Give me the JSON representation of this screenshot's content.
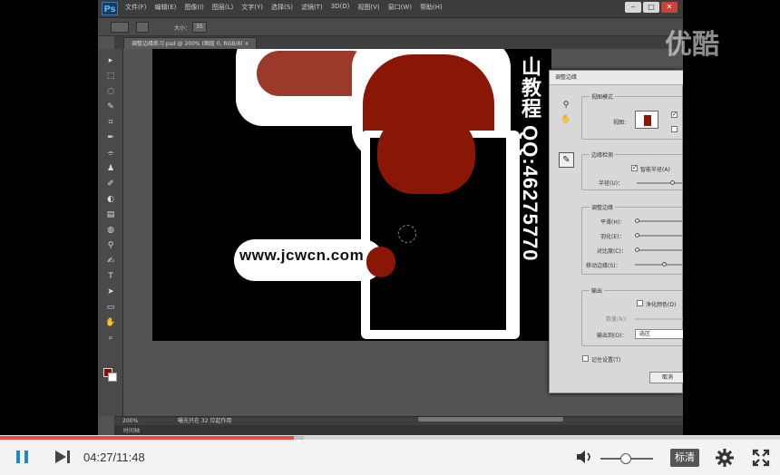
{
  "photoshop": {
    "logo": "Ps",
    "menu": [
      "文件(F)",
      "编辑(E)",
      "图像(I)",
      "图层(L)",
      "文字(Y)",
      "选择(S)",
      "滤镜(T)",
      "3D(D)",
      "视图(V)",
      "窗口(W)",
      "帮助(H)"
    ],
    "window_buttons": [
      "‒",
      "□",
      "✕"
    ],
    "options_bar": {
      "size_label": "大小：",
      "size_value": "35"
    },
    "document_tab": "调整边缘练习.psd @ 200% (图层 0, RGB/8) ×",
    "tools": [
      "▸",
      "⬚",
      "◌",
      "✎",
      "⌗",
      "✒",
      "⌯",
      "♟",
      "✐",
      "◐",
      "▤",
      "◍",
      "⚲",
      "✍",
      "T",
      "➤",
      "▭",
      "✋",
      "⌕"
    ],
    "canvas": {
      "watermark": "www.jcwcn.com",
      "vertical_text": "山教程 QQ:46275770"
    },
    "status": {
      "zoom": "200%",
      "doc_info": "曝光只在 32 位起作用"
    },
    "timeline": "时间轴",
    "dialog": {
      "title": "调整边缘",
      "view_mode": {
        "group": "视图模式",
        "view_label": "视图："
      },
      "edge_detection": {
        "group": "边缘检测",
        "smart_radius": "智能半径(A)",
        "radius": "半径(U)："
      },
      "adjust_edge": {
        "group": "调整边缘",
        "sliders": [
          "平滑(H)：",
          "羽化(E)：",
          "对比度(C)：",
          "移动边缘(S)："
        ]
      },
      "output": {
        "group": "输出",
        "decontaminate": "净化颜色(D)",
        "amount": "数量(N)：",
        "output_to_label": "输出到(O)：",
        "output_to_value": "选区"
      },
      "remember": "记住设置(T)",
      "cancel": "取消"
    }
  },
  "watermark_logo": "优酷",
  "player": {
    "time": "04:27/11:48",
    "progress": 0.377,
    "buffered": 0.39,
    "volume": 0.48,
    "quality": "标清"
  },
  "colors": {
    "accent_red": "#e84c3d",
    "dark_red": "#8a1606"
  }
}
